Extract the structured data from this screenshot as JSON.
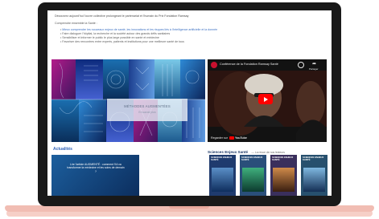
{
  "header": {
    "intro": "Découvrez aujourd'hui l'ouvre collective prolongeant le partenariat et l'humain du Prix Fondation Ramsay",
    "subtitle": "Comprendre ensemble la Santé :",
    "bullets": [
      "Mieux comprendre les nouveaux enjeux de santé, les innovations et les risques liés à l'intelligence artificielle et la donnée",
      "Faire dialoguer l'hôpital, la recherche et la société autour des grands défis sanitaires",
      "Sensibiliser et informer le public le plus large possible en santé et médecine",
      "Favoriser des rencontres entre experts, patients et institutions pour une meilleure santé de tous"
    ]
  },
  "featured": {
    "title": "MÉTHODES AUGMENTÉES",
    "subtitle": "En savoir plus"
  },
  "video": {
    "title": "Conférence de la Fondation Ramsay Santé",
    "share": "Partager",
    "watch_on": "Regarder sur",
    "platform": "YouTube"
  },
  "actualites": {
    "heading": "Actualités",
    "teaser": "Lire l'article AUGMENTÉ : comment l'IA va transformer la médecine et les soins de demain ?"
  },
  "magazines": {
    "heading": "Sciences Enjeux Santé",
    "subheading": "— La revue de nos lecteurs",
    "covers": [
      {
        "title": "SCIENCES ENJEUX SANTÉ",
        "color": "#1f3b6e"
      },
      {
        "title": "SCIENCES ENJEUX SANTÉ",
        "color": "#2a4f7a"
      },
      {
        "title": "SCIENCES ENJEUX SANTÉ",
        "color": "#3a2f5c"
      },
      {
        "title": "SCIENCES ENJEUX SANTÉ",
        "color": "#27506e"
      }
    ]
  }
}
